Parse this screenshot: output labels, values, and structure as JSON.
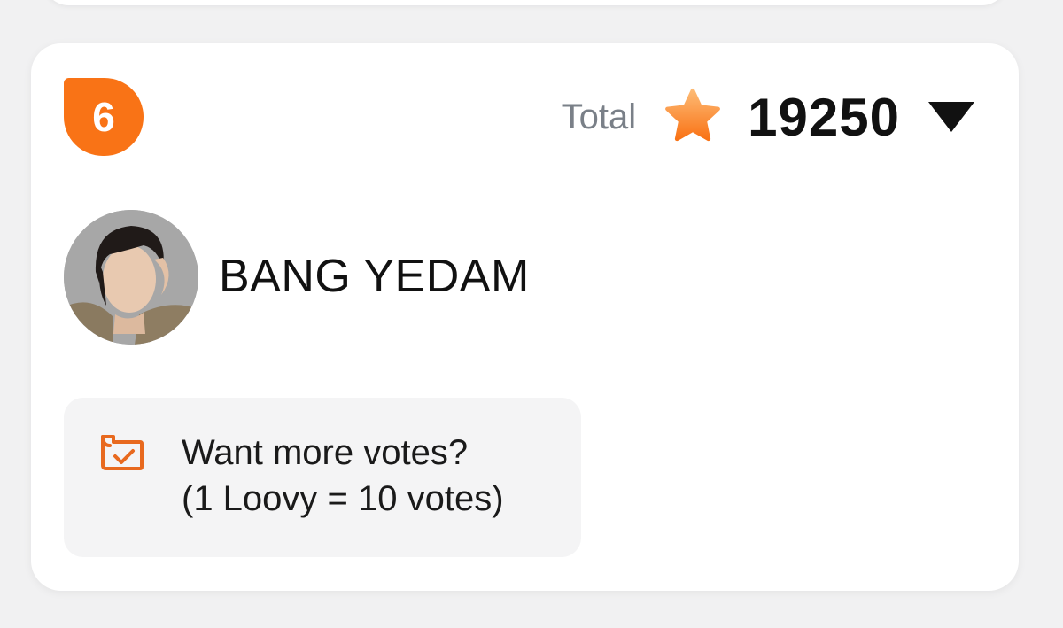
{
  "ranking_item": {
    "rank": "6",
    "total_label": "Total",
    "total_value": "19250",
    "star_icon": "star-icon",
    "toggle_icon": "triangle-down-icon",
    "artist_name": "BANG YEDAM",
    "promo": {
      "icon": "ticket-check-icon",
      "line1": "Want more votes?",
      "line2": "(1 Loovy = 10 votes)"
    }
  },
  "colors": {
    "accent": "#f97316",
    "star": "#fb923c",
    "muted_text": "#7a8088"
  }
}
